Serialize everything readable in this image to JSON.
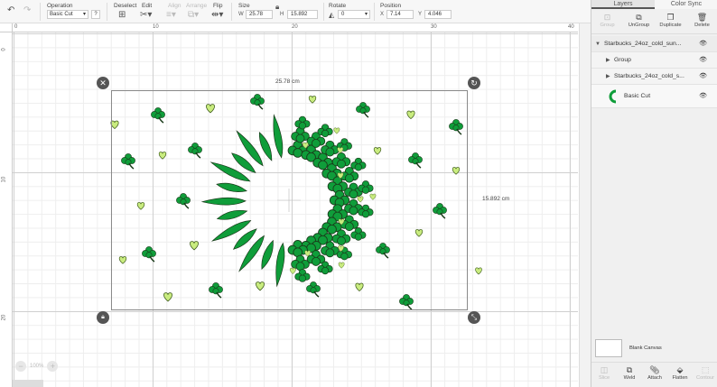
{
  "toolbar": {
    "operation_label": "Operation",
    "operation_value": "Basic Cut",
    "operation_help": "?",
    "deselect_label": "Deselect",
    "edit_label": "Edit",
    "align_label": "Align",
    "arrange_label": "Arrange",
    "flip_label": "Flip",
    "size_label": "Size",
    "width_label": "W",
    "width_value": "25.78",
    "height_label": "H",
    "height_value": "15.892",
    "rotate_label": "Rotate",
    "rotate_value": "0",
    "position_label": "Position",
    "x_label": "X",
    "x_value": "7.14",
    "y_label": "Y",
    "y_value": "4.046"
  },
  "ruler": {
    "top": [
      "0",
      "10",
      "20",
      "30",
      "40"
    ],
    "left": [
      "0",
      "10",
      "20"
    ]
  },
  "canvas": {
    "width_dim": "25.78 cm",
    "height_dim": "15.892 cm",
    "zoom": "100%"
  },
  "panel": {
    "tabs": [
      "Layers",
      "Color Sync"
    ],
    "buttons": [
      "Group",
      "UnGroup",
      "Duplicate",
      "Delete"
    ],
    "layers": [
      {
        "name": "Starbucks_24oz_cold_sun..."
      },
      {
        "name": "Group"
      },
      {
        "name": "Starbucks_24oz_cold_s..."
      },
      {
        "name": "Basic Cut"
      }
    ],
    "blank_canvas": "Blank Canvas",
    "bottom_buttons": [
      "Slice",
      "Weld",
      "Attach",
      "Flatten",
      "Contour"
    ]
  },
  "colors": {
    "dark_green": "#0f9d3a",
    "light_green": "#c9ec7f",
    "green_stroke": "#1a3a1a"
  }
}
